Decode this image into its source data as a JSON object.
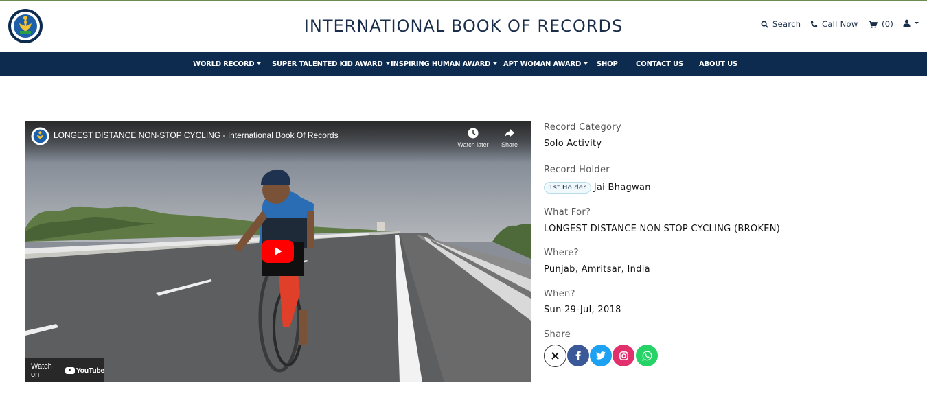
{
  "header": {
    "title": "INTERNATIONAL BOOK OF RECORDS",
    "search_label": "Search",
    "call_label": "Call Now",
    "cart_label": "(0)"
  },
  "nav": {
    "items": [
      {
        "label": "WORLD RECORD",
        "dropdown": true
      },
      {
        "label": "SUPER TALENTED KID AWARD",
        "dropdown": true
      },
      {
        "label": "INSPIRING HUMAN AWARD",
        "dropdown": true
      },
      {
        "label": "APT WOMAN AWARD",
        "dropdown": true
      },
      {
        "label": "SHOP",
        "dropdown": false
      },
      {
        "label": "CONTACT US",
        "dropdown": false
      },
      {
        "label": "ABOUT US",
        "dropdown": false
      }
    ]
  },
  "video": {
    "title": "LONGEST DISTANCE NON-STOP CYCLING - International Book Of Records",
    "watch_later": "Watch later",
    "share": "Share",
    "watch_on": "Watch on",
    "youtube": "YouTube"
  },
  "record": {
    "category_label": "Record Category",
    "category": "Solo Activity",
    "holder_label": "Record Holder",
    "holder_badge": "1st Holder",
    "holder": "Jai Bhagwan",
    "what_label": "What For?",
    "what": "LONGEST DISTANCE NON STOP CYCLING (BROKEN)",
    "where_label": "Where?",
    "where": "Punjab, Amritsar, India",
    "when_label": "When?",
    "when": "Sun 29-Jul, 2018",
    "share_label": "Share"
  },
  "share_buttons": [
    {
      "icon": "x-icon",
      "color": "#ffffff"
    },
    {
      "icon": "facebook-icon",
      "color": "#3b5998"
    },
    {
      "icon": "twitter-icon",
      "color": "#1da1f2"
    },
    {
      "icon": "instagram-icon",
      "color": "#e1306c"
    },
    {
      "icon": "whatsapp-icon",
      "color": "#25d366"
    }
  ],
  "colors": {
    "nav_bg": "#0d2b4e",
    "title": "#1a2e4a",
    "youtube_red": "#ff0000"
  }
}
